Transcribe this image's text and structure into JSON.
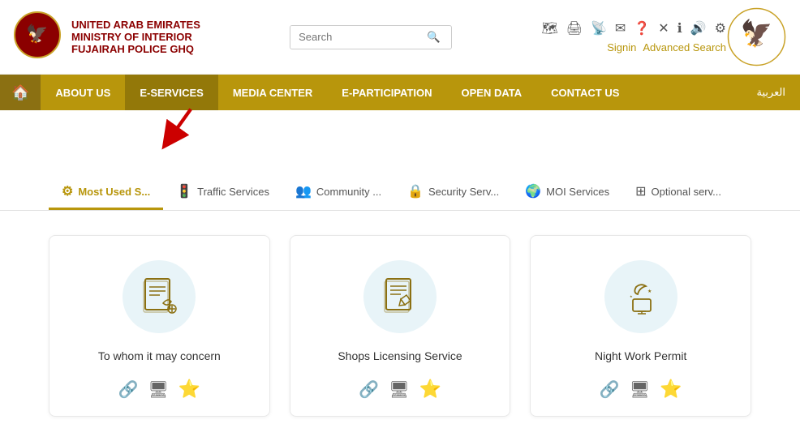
{
  "header": {
    "org_line1": "UNITED ARAB EMIRATES",
    "org_line2": "MINISTRY OF INTERIOR",
    "org_line3": "FUJAIRAH POLICE GHQ",
    "search_placeholder": "Search",
    "signin_label": "Signin",
    "advanced_search_label": "Advanced Search"
  },
  "nav": {
    "home_icon": "🏠",
    "items": [
      {
        "label": "ABOUT US",
        "active": false
      },
      {
        "label": "E-SERVICES",
        "active": true
      },
      {
        "label": "MEDIA CENTER",
        "active": false
      },
      {
        "label": "E-PARTICIPATION",
        "active": false
      },
      {
        "label": "OPEN DATA",
        "active": false
      },
      {
        "label": "CONTACT US",
        "active": false
      }
    ],
    "arabic_label": "العربية"
  },
  "tabs": [
    {
      "label": "Most Used S...",
      "active": true,
      "icon": "⚙"
    },
    {
      "label": "Traffic Services",
      "active": false,
      "icon": "🚦"
    },
    {
      "label": "Community ...",
      "active": false,
      "icon": "👥"
    },
    {
      "label": "Security Serv...",
      "active": false,
      "icon": "🔒"
    },
    {
      "label": "MOI Services",
      "active": false,
      "icon": "🌍"
    },
    {
      "label": "Optional serv...",
      "active": false,
      "icon": "⊞"
    }
  ],
  "cards": [
    {
      "title": "To whom it may concern",
      "link_icon": "🔗",
      "screen_icon": "🖥",
      "star_icon": "⭐"
    },
    {
      "title": "Shops Licensing Service",
      "link_icon": "🔗",
      "screen_icon": "🖥",
      "star_icon": "⭐"
    },
    {
      "title": "Night Work Permit",
      "link_icon": "🔗",
      "screen_icon": "🖥",
      "star_icon": "⭐"
    }
  ]
}
